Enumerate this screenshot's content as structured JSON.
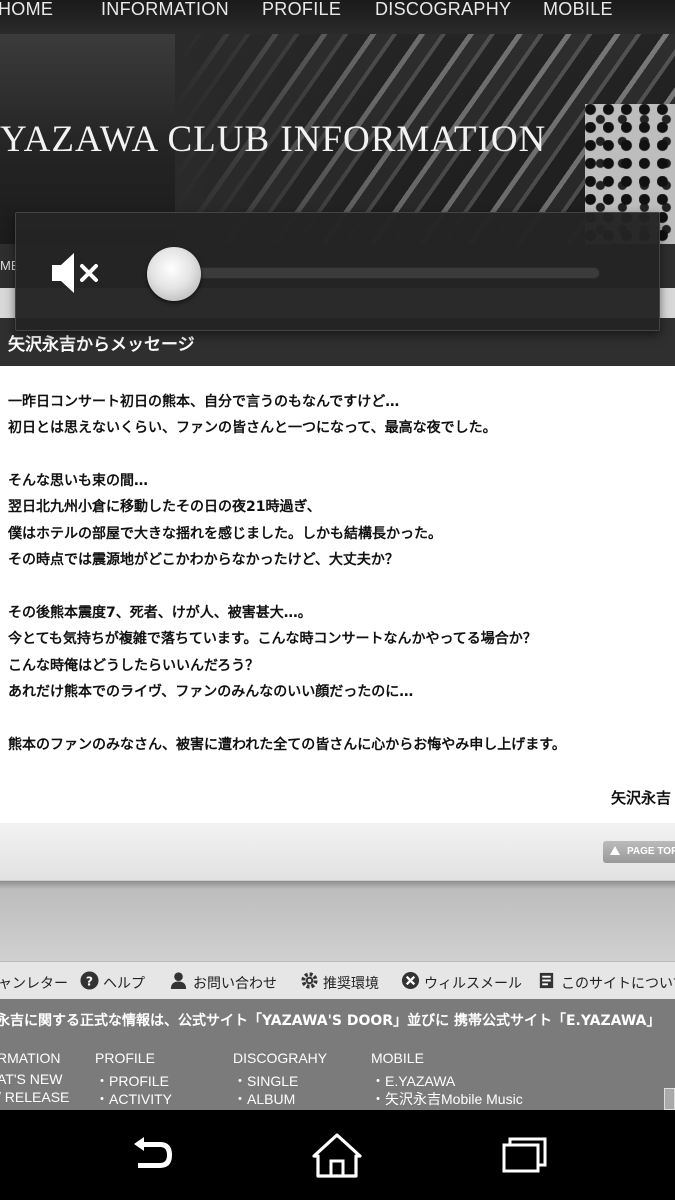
{
  "topnav": {
    "items": [
      "HOME",
      "INFORMATION",
      "PROFILE",
      "DISCOGRAPHY",
      "MOBILE"
    ]
  },
  "banner": {
    "title": "YAZAWA CLUB INFORMATION"
  },
  "subnav": {
    "item": "ME"
  },
  "volume_overlay": {
    "level": 0,
    "muted": true,
    "icon": "volume-mute-icon"
  },
  "article": {
    "heading": "矢沢永吉からメッセージ",
    "lines": [
      "一昨日コンサート初日の熊本、自分で言うのもなんですけど…",
      "初日とは思えないくらい、ファンの皆さんと一つになって、最高な夜でした。",
      "",
      "そんな思いも束の間…",
      "翌日北九州小倉に移動したその日の夜21時過ぎ、",
      "僕はホテルの部屋で大きな揺れを感じました。しかも結構長かった。",
      "その時点では震源地がどこかわからなかったけど、大丈夫か？",
      "",
      "その後熊本震度7、死者、けが人、被害甚大…。",
      "今とても気持ちが複雑で落ちています。こんな時コンサートなんかやってる場合か？",
      "こんな時俺はどうしたらいいんだろう？",
      "あれだけ熊本でのライヴ、ファンのみんなのいい顔だったのに…",
      "",
      "熊本のファンのみなさん、被害に遭われた全ての皆さんに心からお悔やみ申し上げます。"
    ],
    "signature": "矢沢永吉"
  },
  "page_top": {
    "label": "PAGE TOP"
  },
  "footer_links": [
    {
      "label": "ャンレター",
      "icon": "none"
    },
    {
      "label": "ヘルプ",
      "icon": "help-icon"
    },
    {
      "label": "お問い合わせ",
      "icon": "contact-icon"
    },
    {
      "label": "推奨環境",
      "icon": "gear-icon"
    },
    {
      "label": "ウィルスメール",
      "icon": "virus-icon"
    },
    {
      "label": "このサイトについて",
      "icon": "site-icon"
    }
  ],
  "notice": "永吉に関する正式な情報は、公式サイト「YAZAWA'S DOOR」並びに 携帯公式サイト「E.YAZAWA」",
  "sitemap": {
    "columns": [
      {
        "head": "RMATION",
        "items": [
          "AT'S NEW",
          "/ RELEASE"
        ]
      },
      {
        "head": "PROFILE",
        "items": [
          "・PROFILE",
          "・ACTIVITY"
        ]
      },
      {
        "head": "DISCOGRAHY",
        "items": [
          "・SINGLE",
          "・ALBUM"
        ]
      },
      {
        "head": "MOBILE",
        "items": [
          "・E.YAZAWA",
          "・矢沢永吉Mobile Music"
        ]
      }
    ]
  },
  "android_nav": [
    "back",
    "home",
    "recents"
  ]
}
